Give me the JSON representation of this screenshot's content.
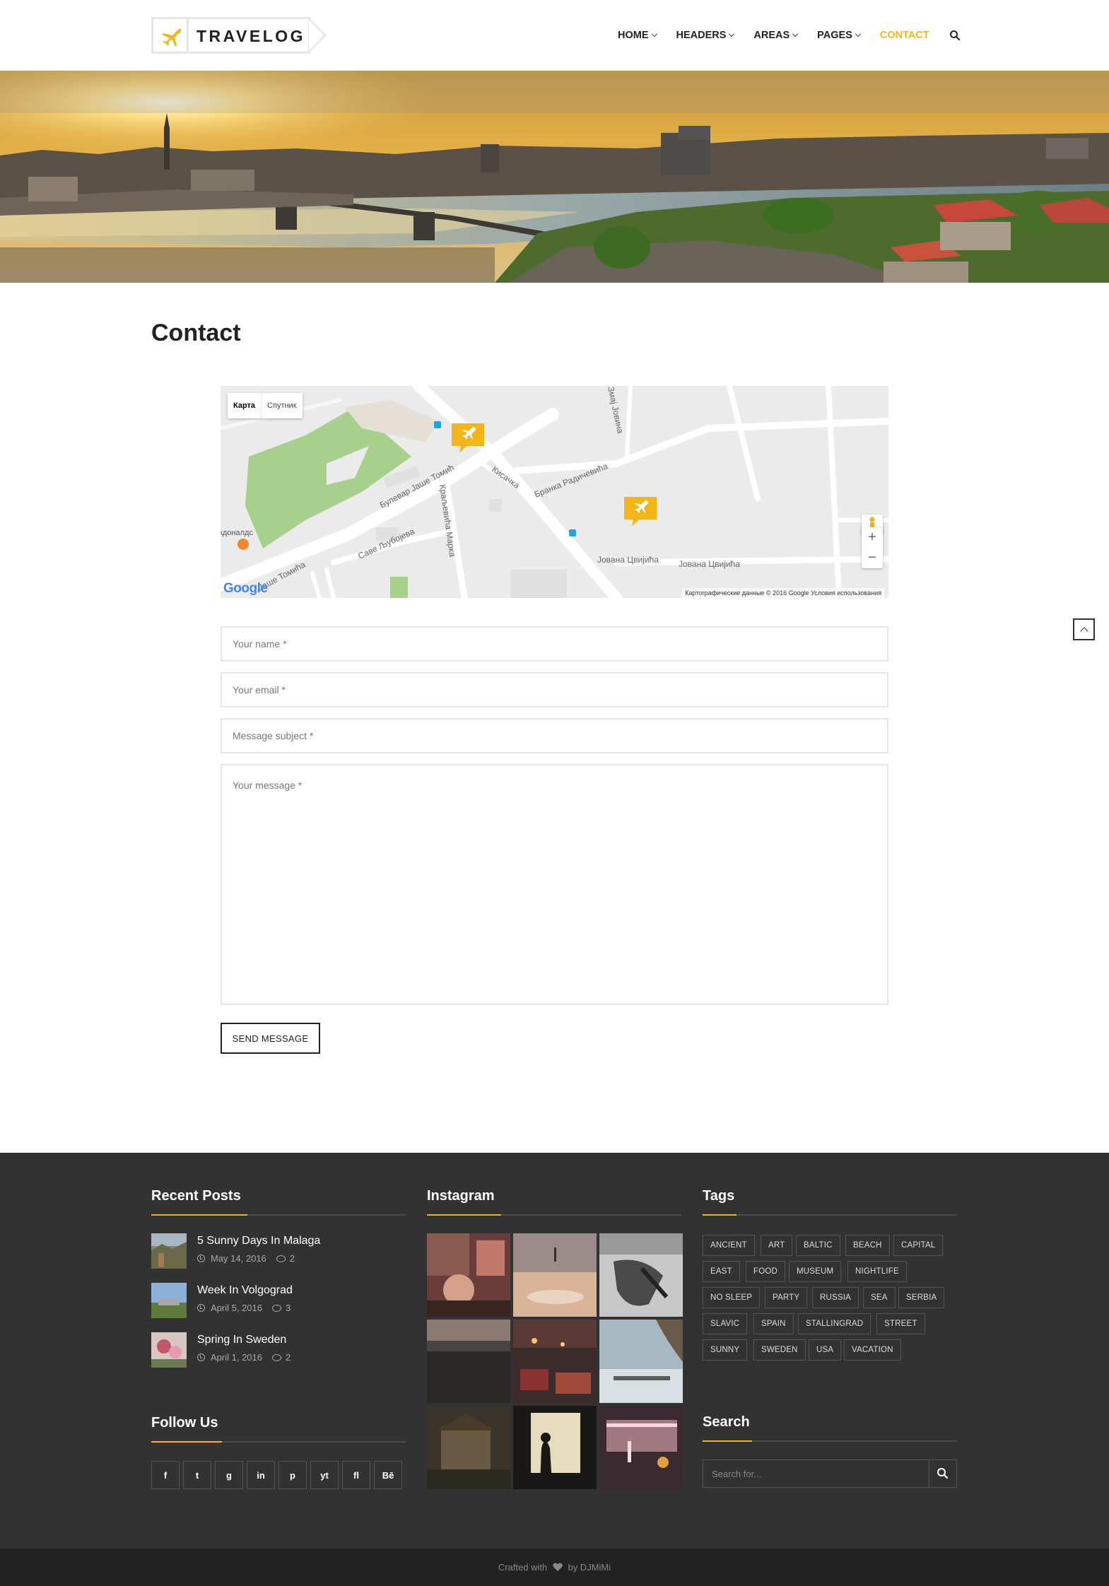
{
  "brand": {
    "name": "TRAVELOG",
    "accent": "#f3b519"
  },
  "nav": {
    "items": [
      {
        "label": "HOME",
        "dropdown": true
      },
      {
        "label": "HEADERS",
        "dropdown": true
      },
      {
        "label": "AREAS",
        "dropdown": true
      },
      {
        "label": "PAGES",
        "dropdown": true
      },
      {
        "label": "CONTACT",
        "dropdown": false,
        "active": true
      }
    ],
    "search_icon": "search-icon"
  },
  "page": {
    "title": "Contact"
  },
  "map": {
    "toggle": [
      "Карта",
      "Спутник"
    ],
    "credit": "Картографические данные © 2016 Google    Условия использования",
    "logo": "Google",
    "streets": [
      "Булевар Јаше Томић",
      "Кисачка",
      "Бранка Радичевића",
      "Краљевића Марка",
      "Саве Љубојева",
      "Јаше Томића",
      "Јована Цвијића",
      "Јована Цвијића",
      "Змај Јовина"
    ],
    "poi": "кдоналдс",
    "zoom": [
      "+",
      "−"
    ]
  },
  "form": {
    "name_placeholder": "Your name *",
    "email_placeholder": "Your email *",
    "subject_placeholder": "Message subject *",
    "message_placeholder": "Your message *",
    "submit_label": "SEND MESSAGE"
  },
  "footer": {
    "recent_posts": {
      "title": "Recent Posts",
      "posts": [
        {
          "title": "5 Sunny Days In Malaga",
          "date": "May 14, 2016",
          "comments": "2"
        },
        {
          "title": "Week In Volgograd",
          "date": "April 5, 2016",
          "comments": "3"
        },
        {
          "title": "Spring In Sweden",
          "date": "April 1, 2016",
          "comments": "2"
        }
      ]
    },
    "instagram": {
      "title": "Instagram"
    },
    "tags": {
      "title": "Tags",
      "items": [
        "ANCIENT",
        "ART",
        "BALTIC",
        "BEACH",
        "CAPITAL",
        "EAST",
        "FOOD",
        "MUSEUM",
        "NIGHTLIFE",
        "NO SLEEP",
        "PARTY",
        "RUSSIA",
        "SEA",
        "SERBIA",
        "SLAVIC",
        "SPAIN",
        "STALLINGRAD",
        "STREET",
        "SUNNY",
        "SWEDEN",
        "USA",
        "VACATION"
      ]
    },
    "follow": {
      "title": "Follow Us",
      "networks": [
        "f",
        "t",
        "g",
        "in",
        "p",
        "yt",
        "fl",
        "Bē"
      ]
    },
    "search": {
      "title": "Search",
      "placeholder": "Search for..."
    }
  },
  "credits": {
    "prefix": "Crafted with",
    "suffix": "by DJMiMi"
  }
}
